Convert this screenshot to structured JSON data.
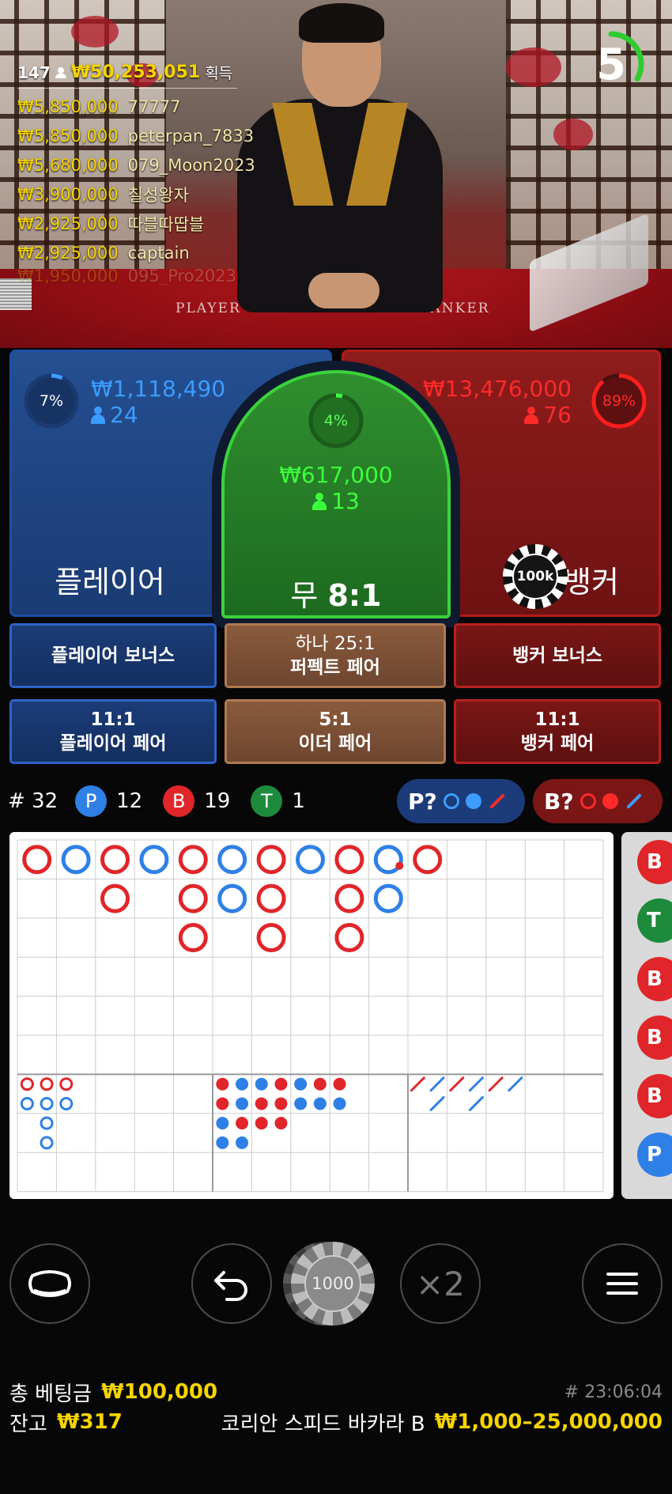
{
  "overlay": {
    "viewers": "147",
    "total_won": "₩50,253,051",
    "won_label": "획득",
    "winners": [
      {
        "amount": "₩5,850,000",
        "name": "77777"
      },
      {
        "amount": "₩5,850,000",
        "name": "peterpan_7833"
      },
      {
        "amount": "₩5,680,000",
        "name": "079_Moon2023"
      },
      {
        "amount": "₩3,900,000",
        "name": "칠성왕자"
      },
      {
        "amount": "₩2,925,000",
        "name": "따블따땁블"
      },
      {
        "amount": "₩2,925,000",
        "name": "captain"
      },
      {
        "amount": "₩1,950,000",
        "name": "095_Pro2023"
      }
    ]
  },
  "table_felt": {
    "player": "PLAYER",
    "banker": "BANKER"
  },
  "timer": {
    "seconds": "5",
    "progress": 0.33
  },
  "player": {
    "percent": "7%",
    "percent_value": 0.07,
    "amount": "₩1,118,490",
    "count": "24",
    "label": "플레이어"
  },
  "tie": {
    "percent": "4%",
    "percent_value": 0.04,
    "amount": "₩617,000",
    "count": "13",
    "label_main": "무",
    "label_odds": "8:1"
  },
  "banker": {
    "percent": "89%",
    "percent_value": 0.89,
    "amount": "₩13,476,000",
    "count": "76",
    "label": "뱅커"
  },
  "placed_chip": "100k",
  "side_bets": {
    "player_bonus": "플레이어 보너스",
    "perfect_pair_odds": "하나 25:1",
    "perfect_pair": "퍼펙트 페어",
    "banker_bonus": "뱅커 보너스",
    "player_pair_odds": "11:1",
    "player_pair": "플레이어 페어",
    "either_pair_odds": "5:1",
    "either_pair": "이더 페어",
    "banker_pair_odds": "11:1",
    "banker_pair": "뱅커 페어"
  },
  "stats": {
    "round_label": "# 32",
    "p_letter": "P",
    "p_count": "12",
    "b_letter": "B",
    "b_count": "19",
    "t_letter": "T",
    "t_count": "1"
  },
  "predict": {
    "player": "P?",
    "banker": "B?"
  },
  "roadmap": {
    "big_road": [
      [
        "B"
      ],
      [
        "P"
      ],
      [
        "B",
        "B"
      ],
      [
        "P"
      ],
      [
        "B",
        "B",
        "B"
      ],
      [
        "P",
        "P"
      ],
      [
        "B",
        "B",
        "B"
      ],
      [
        "P"
      ],
      [
        "B",
        "B",
        "B"
      ],
      [
        "P*",
        "P"
      ],
      [
        "B"
      ]
    ],
    "big_eye_boy": [
      [
        "R",
        "B"
      ],
      [
        "R",
        "B",
        "B",
        "B"
      ],
      [
        "R",
        "B"
      ]
    ],
    "small_road": [
      [
        "R",
        "R",
        "B",
        "B"
      ],
      [
        "B",
        "B",
        "R",
        "B"
      ],
      [
        "B",
        "R",
        "R"
      ],
      [
        "R",
        "R",
        "R"
      ],
      [
        "B",
        "B"
      ],
      [
        "R",
        "B"
      ],
      [
        "R",
        "B"
      ]
    ],
    "cockroach_pig": [
      [
        "R"
      ],
      [
        "B",
        "B"
      ],
      [
        "R"
      ],
      [
        "B",
        "B"
      ],
      [
        "R"
      ],
      [
        "B"
      ]
    ],
    "side_column": [
      "B",
      "T",
      "B",
      "B",
      "B",
      "P"
    ]
  },
  "colors": {
    "player": "#2f80e6",
    "banker": "#e0262a",
    "tie": "#1e8a3c",
    "accent": "#f5d400"
  },
  "controls": {
    "chip_value": "1000",
    "double": "×2"
  },
  "footer": {
    "total_bet_label": "총 베팅금",
    "total_bet": "₩100,000",
    "round_id": "# 23:06:04",
    "balance_label": "잔고",
    "balance": "₩317",
    "table_name": "코리안 스피드 바카라 B",
    "limits": "₩1,000–25,000,000"
  }
}
